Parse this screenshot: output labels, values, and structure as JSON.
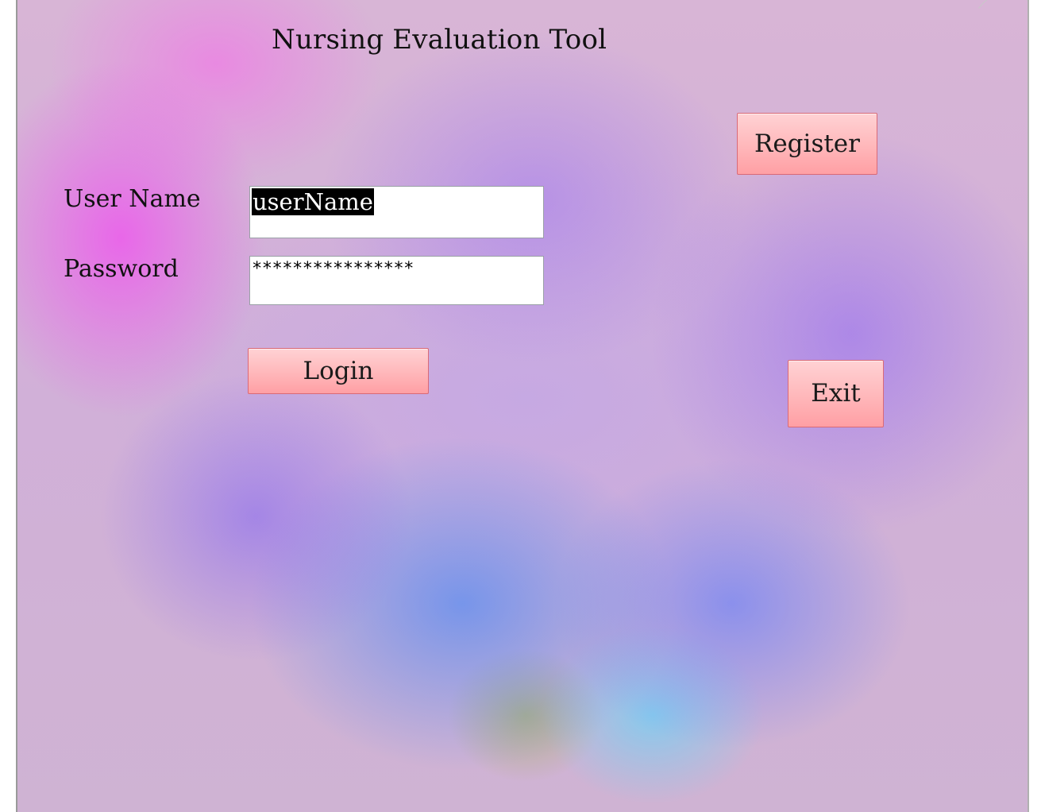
{
  "app": {
    "title": "Nursing Evaluation Tool"
  },
  "form": {
    "username_label": "User Name",
    "username_value": "userName",
    "password_label": "Password",
    "password_value": "****************"
  },
  "buttons": {
    "register": "Register",
    "login": "Login",
    "exit": "Exit"
  },
  "colors": {
    "button_fill": "#ffb7ba",
    "button_border": "#d96a77",
    "selection": "#000000"
  }
}
